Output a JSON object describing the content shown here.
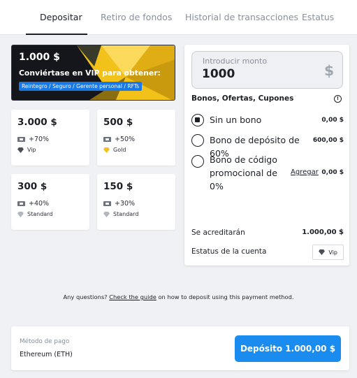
{
  "tabs": [
    {
      "label": "Depositar",
      "active": true
    },
    {
      "label": "Retiro de fondos",
      "active": false
    },
    {
      "label": "Historial de transacciones",
      "active": false
    },
    {
      "label": "Estatus",
      "active": false
    }
  ],
  "vip_banner": {
    "amount": "1.000 $",
    "title": "Conviértase en VIP para obtener:",
    "perks": "Reintegro / Seguro / Gerente personal / RFTs"
  },
  "tiles": [
    {
      "amount": "3.000 $",
      "bonus": "+70%",
      "level": "Vip",
      "level_icon": "diamond-icon"
    },
    {
      "amount": "500 $",
      "bonus": "+50%",
      "level": "Gold",
      "level_icon": "gold-gem-icon"
    },
    {
      "amount": "300 $",
      "bonus": "+40%",
      "level": "Standard",
      "level_icon": "gem-icon"
    },
    {
      "amount": "150 $",
      "bonus": "+30%",
      "level": "Standard",
      "level_icon": "gem-icon"
    }
  ],
  "amount_field": {
    "label": "Introducir monto",
    "value": "1000",
    "currency": "$"
  },
  "bonuses": {
    "header": "Bonos, Ofertas, Cupones",
    "options": [
      {
        "label": "Sin un bono",
        "value": "0,00 $",
        "selected": true
      },
      {
        "label": "Bono de depósito de 60%",
        "value": "600,00 $",
        "selected": false
      },
      {
        "label": "Bono de código promocional de 0%",
        "value": "0,00 $",
        "selected": false,
        "link": "Agregar"
      }
    ]
  },
  "summary": {
    "credit_label": "Se acreditarán",
    "credit_value": "1.000,00 $",
    "status_label": "Estatus de la cuenta",
    "status_value": "Vip"
  },
  "help": {
    "prefix": "Any questions?",
    "link": "Check the guide",
    "suffix": "on how to deposit using this payment method."
  },
  "footer": {
    "payment_label": "Método de pago",
    "payment_value": "Ethereum (ETH)",
    "deposit_button": "Depósito 1.000,00 $"
  },
  "colors": {
    "accent": "#1a8cf0",
    "banner_gold": "#f2c21b",
    "perk_pill": "#1778e6"
  }
}
